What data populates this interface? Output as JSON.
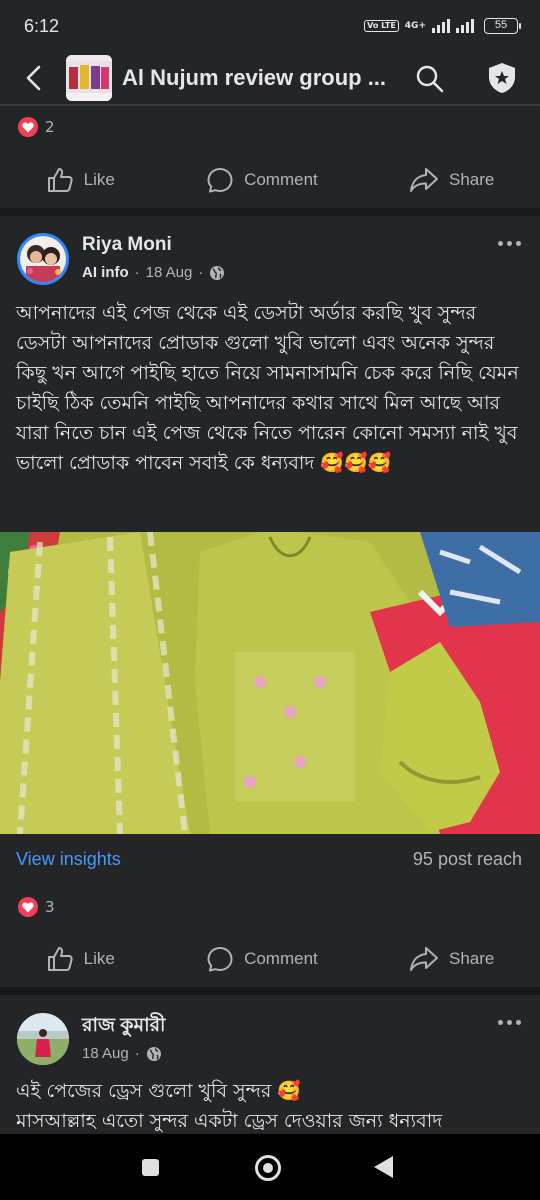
{
  "status_bar": {
    "time": "6:12",
    "network_label": "4G+",
    "volte_label": "Vo LTE",
    "battery": "55"
  },
  "header": {
    "title": "Al Nujum review group ...",
    "icons": [
      "back-arrow-icon",
      "search-icon",
      "shield-star-icon"
    ]
  },
  "previous_post": {
    "reaction_count": "2",
    "actions": {
      "like": "Like",
      "comment": "Comment",
      "share": "Share"
    }
  },
  "post": {
    "author": "Riya Moni",
    "badge": "AI info",
    "date": "18 Aug",
    "text": "আপনাদের এই পেজ থেকে এই ডেসটা  অর্ডার করছি খুব সুন্দর ডেসটা আপনাদের প্রোডাক গুলো খুবি ভালো এবং অনেক সুন্দর কিছু খন আগে পাইছি হাতে নিয়ে সামনাসামনি চেক করে নিছি যেমন চাইছি ঠিক তেমনি পাইছি আপনাদের কথার সাথে মিল আছে আর যারা নিতে চান এই পেজ থেকে নিতে পারেন কোনো সমস্যা নাই খুব ভালো প্রোডাক পাবেন সবাই কে ধন্যবাদ 🥰🥰🥰",
    "insights_label": "View insights",
    "reach": "95 post reach",
    "reaction_count": "3",
    "actions": {
      "like": "Like",
      "comment": "Comment",
      "share": "Share"
    }
  },
  "next_post": {
    "author": "রাজ কুমারী",
    "date": "18 Aug",
    "text_line1": "এই পেজের ড্রেস গুলো খুবি সুন্দর 🥰",
    "text_line2": "মাসআল্লাহ এতো সুন্দর একটা ড্রেস দেওয়ার জন্য ধন্যবাদ"
  },
  "colors": {
    "background": "#242526",
    "separator": "#18191a",
    "link_blue": "#4599ff",
    "heart_red": "#f33e58"
  }
}
